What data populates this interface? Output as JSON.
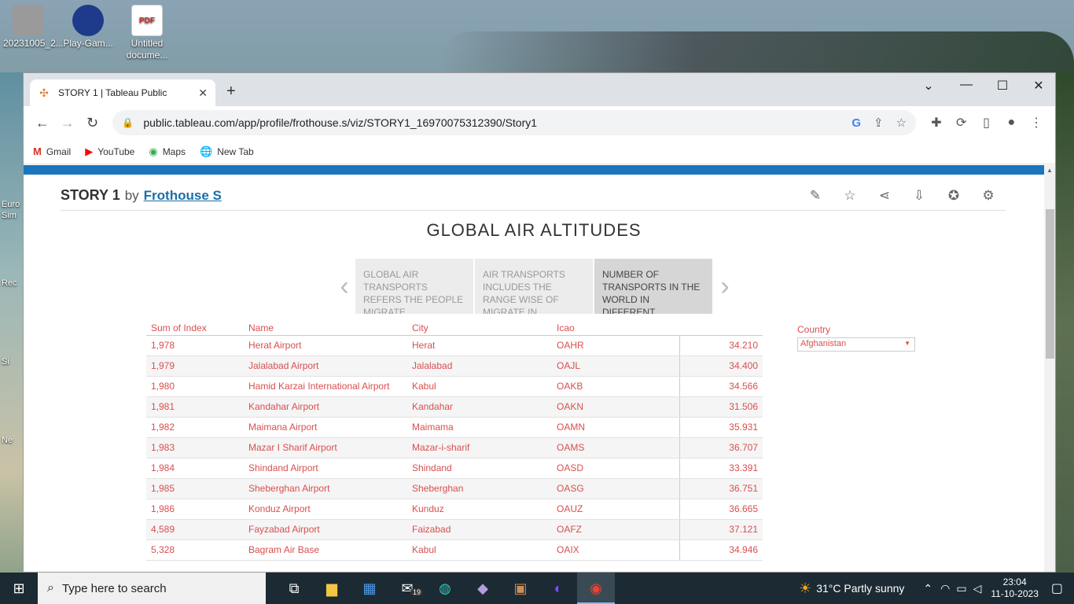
{
  "desktop": {
    "icons": [
      {
        "label": "20231005_2..."
      },
      {
        "label": "Play-Gam..."
      },
      {
        "label": "Untitled docume..."
      }
    ],
    "left_labels": [
      "Euro",
      "Sim",
      "Rec",
      "Si",
      "Ne"
    ]
  },
  "browser": {
    "tab_title": "STORY 1 | Tableau Public",
    "url": "public.tableau.com/app/profile/frothouse.s/viz/STORY1_16970075312390/Story1",
    "bookmarks": [
      "Gmail",
      "YouTube",
      "Maps",
      "New Tab"
    ]
  },
  "story": {
    "title": "STORY 1",
    "by": "by",
    "author": "Frothouse S",
    "viz_title": "GLOBAL AIR ALTITUDES",
    "points": [
      "GLOBAL AIR TRANSPORTS REFERS THE PEOPLE MIGRATE",
      "AIR TRANSPORTS INCLUDES THE RANGE WISE OF MIGRATE IN",
      "NUMBER OF TRANSPORTS IN THE WORLD IN DIFFERENT"
    ],
    "active_point": 2
  },
  "table": {
    "headers": [
      "Sum of Index",
      "Name",
      "City",
      "Icao",
      ""
    ],
    "rows": [
      [
        "1,978",
        "Herat Airport",
        "Herat",
        "OAHR",
        "34.210"
      ],
      [
        "1,979",
        "Jalalabad Airport",
        "Jalalabad",
        "OAJL",
        "34.400"
      ],
      [
        "1,980",
        "Hamid Karzai International Airport",
        "Kabul",
        "OAKB",
        "34.566"
      ],
      [
        "1,981",
        "Kandahar Airport",
        "Kandahar",
        "OAKN",
        "31.506"
      ],
      [
        "1,982",
        "Maimana Airport",
        "Maimama",
        "OAMN",
        "35.931"
      ],
      [
        "1,983",
        "Mazar I Sharif Airport",
        "Mazar-i-sharif",
        "OAMS",
        "36.707"
      ],
      [
        "1,984",
        "Shindand Airport",
        "Shindand",
        "OASD",
        "33.391"
      ],
      [
        "1,985",
        "Sheberghan Airport",
        "Sheberghan",
        "OASG",
        "36.751"
      ],
      [
        "1,986",
        "Konduz Airport",
        "Kunduz",
        "OAUZ",
        "36.665"
      ],
      [
        "4,589",
        "Fayzabad Airport",
        "Faizabad",
        "OAFZ",
        "37.121"
      ],
      [
        "5,328",
        "Bagram Air Base",
        "Kabul",
        "OAIX",
        "34.946"
      ]
    ]
  },
  "filter": {
    "label": "Country",
    "value": "Afghanistan"
  },
  "taskbar": {
    "search_placeholder": "Type here to search",
    "mail_badge": "19",
    "weather": "31°C  Partly sunny",
    "time": "23:04",
    "date": "11-10-2023"
  }
}
